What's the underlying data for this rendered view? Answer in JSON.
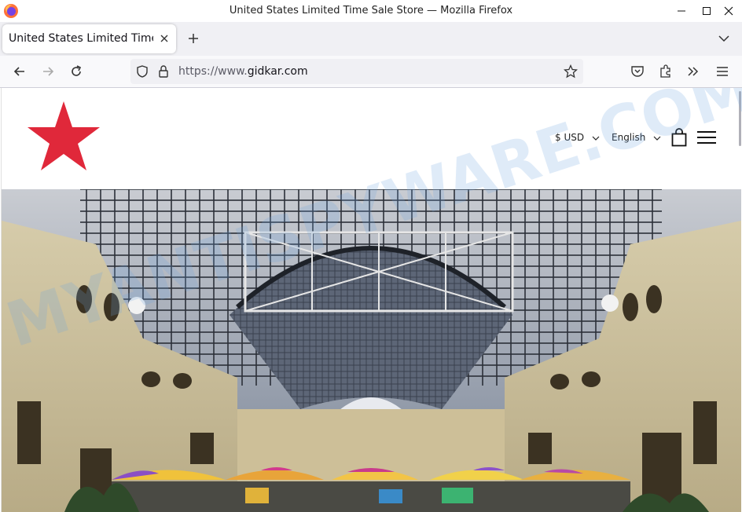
{
  "window": {
    "title": "United States Limited Time Sale Store — Mozilla Firefox"
  },
  "tabs": [
    {
      "label": "United States Limited Time Sale Store",
      "active": true
    }
  ],
  "navbar": {
    "url_prefix": "https://www.",
    "url_domain": "gidkar.com"
  },
  "site": {
    "currency": "$ USD",
    "language": "English",
    "logo": "red-star-logo",
    "accent_color": "#e0283a"
  },
  "hero": {
    "description": "shopping-arcade-glass-roof-photo"
  },
  "watermark": {
    "text": "MYANTISPYWARE.COM"
  }
}
